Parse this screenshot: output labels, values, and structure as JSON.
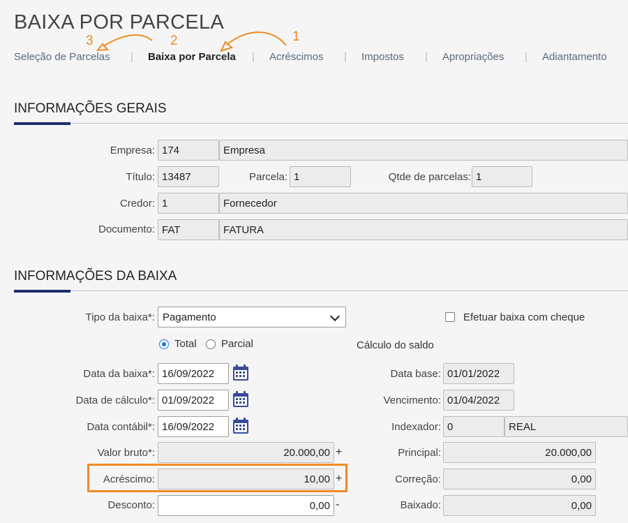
{
  "page": {
    "title": "BAIXA POR PARCELA"
  },
  "tabs": [
    {
      "label": "Seleção de Parcelas"
    },
    {
      "label": "Baixa por Parcela"
    },
    {
      "label": "Acréscimos"
    },
    {
      "label": "Impostos"
    },
    {
      "label": "Apropriações"
    },
    {
      "label": "Adiantamento"
    }
  ],
  "annotations": {
    "n1": "1",
    "n2": "2",
    "n3": "3"
  },
  "gerais": {
    "title": "INFORMAÇÕES GERAIS",
    "empresa": {
      "label": "Empresa:",
      "code": "174",
      "name": "Empresa"
    },
    "titulo": {
      "label": "Título:",
      "value": "13487"
    },
    "parcela": {
      "label": "Parcela:",
      "value": "1"
    },
    "qtde": {
      "label": "Qtde de parcelas:",
      "value": "1"
    },
    "credor": {
      "label": "Credor:",
      "code": "1",
      "name": "Fornecedor"
    },
    "documento": {
      "label": "Documento:",
      "code": "FAT",
      "name": "FATURA"
    }
  },
  "baixa": {
    "title": "INFORMAÇÕES DA BAIXA",
    "tipo": {
      "label": "Tipo da baixa*:",
      "value": "Pagamento"
    },
    "cheque": {
      "label": "Efetuar baixa com cheque",
      "checked": false
    },
    "radio_total": "Total",
    "radio_parcial": "Parcial",
    "calculo_title": "Cálculo do saldo",
    "data_baixa": {
      "label": "Data da baixa*:",
      "value": "16/09/2022"
    },
    "data_calculo": {
      "label": "Data de cálculo*:",
      "value": "01/09/2022"
    },
    "data_contabil": {
      "label": "Data contábil*:",
      "value": "16/09/2022"
    },
    "valor_bruto": {
      "label": "Valor bruto*:",
      "value": "20.000,00",
      "sign": "+"
    },
    "acrescimo": {
      "label": "Acréscimo:",
      "value": "10,00",
      "sign": "+"
    },
    "desconto": {
      "label": "Desconto:",
      "value": "0,00",
      "sign": "-"
    },
    "data_base": {
      "label": "Data base:",
      "value": "01/01/2022"
    },
    "vencimento": {
      "label": "Vencimento:",
      "value": "01/04/2022"
    },
    "indexador": {
      "label": "Indexador:",
      "code": "0",
      "name": "REAL"
    },
    "principal": {
      "label": "Principal:",
      "value": "20.000,00"
    },
    "correcao": {
      "label": "Correção:",
      "value": "0,00"
    },
    "baixado": {
      "label": "Baixado:",
      "value": "0,00"
    }
  },
  "colors": {
    "annotation": "#f08a24",
    "accent": "#1f2d6b",
    "radio": "#1a73e8",
    "calendar": "#3a4a9a"
  }
}
